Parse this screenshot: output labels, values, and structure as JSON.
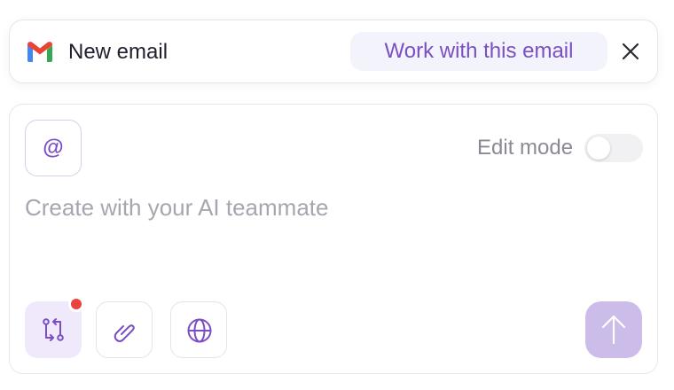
{
  "email_card": {
    "app_icon": "gmail-icon",
    "title": "New email",
    "work_button_label": "Work with this email",
    "close_icon": "close-icon"
  },
  "compose": {
    "mention_symbol": "@",
    "edit_mode_label": "Edit mode",
    "edit_mode_on": false,
    "input_placeholder": "Create with your AI teammate",
    "input_value": "",
    "tools": [
      {
        "icon": "switch-arrows-icon",
        "active": true,
        "has_notification": true
      },
      {
        "icon": "paperclip-icon",
        "active": false,
        "has_notification": false
      },
      {
        "icon": "globe-icon",
        "active": false,
        "has_notification": false
      }
    ],
    "send_icon": "arrow-up-icon"
  },
  "colors": {
    "accent": "#7a4fc4",
    "accent_soft": "#efe9fb",
    "send_button": "#cbbcea",
    "notification": "#e8433f",
    "muted_text": "#8a8a95"
  }
}
